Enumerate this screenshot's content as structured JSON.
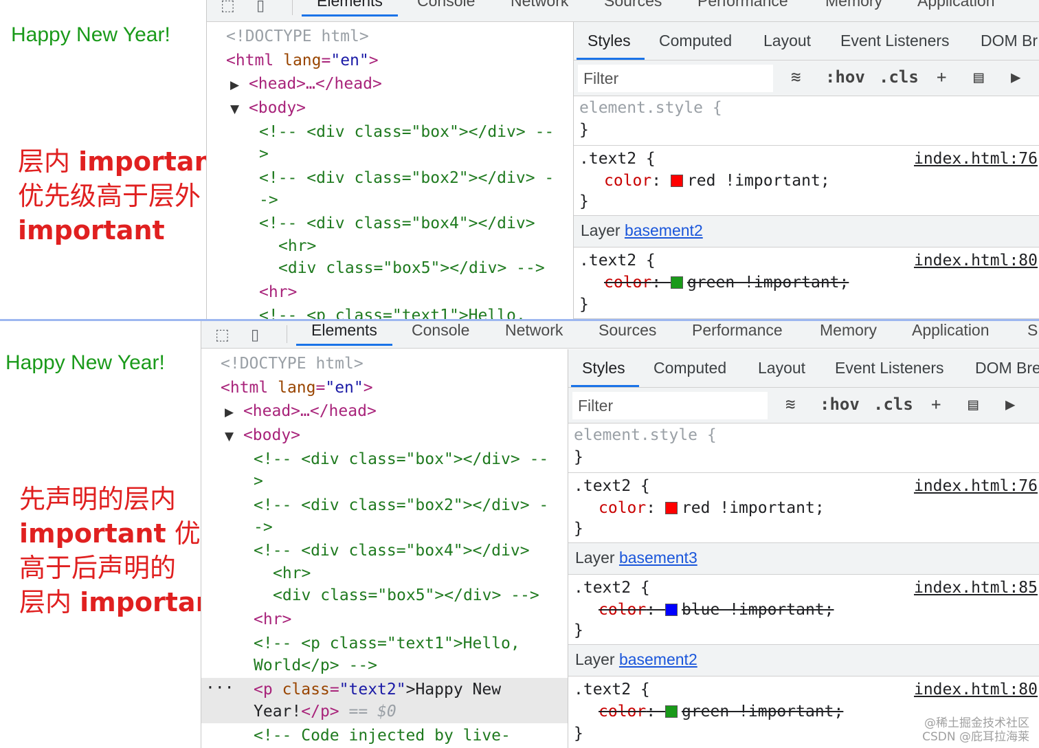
{
  "colors": {
    "tab_accent": "#1a73e8",
    "red": "#ff0000",
    "green": "#1a9a1a",
    "blue": "#0000ff"
  },
  "toolbar": {
    "inspect_icon": "inspect-element-icon",
    "device_icon": "device-toolbar-icon"
  },
  "top": {
    "happy": "Happy New Year!",
    "note_lines": [
      "层内 important",
      "优先级高于层外",
      "important"
    ],
    "tabs": [
      "Elements",
      "Console",
      "Network",
      "Sources",
      "Performance",
      "Memory",
      "Application"
    ],
    "elements": {
      "doctype": "<!DOCTYPE html>",
      "html_open": "<html",
      "html_attr": "lang",
      "html_val": "\"en\"",
      "gt": ">",
      "head": "<head>…</head>",
      "body": "<body>",
      "c1": "<!-- <div class=\"box\"></div> --",
      "c1b": ">",
      "c2": "<!-- <div class=\"box2\"></div> -",
      "c2b": "->",
      "c3": "<!-- <div class=\"box4\"></div>",
      "c3b": "<hr>",
      "c3c": "<div class=\"box5\"></div> -->",
      "hr": "<hr>",
      "c4": "<!-- <p class=\"text1\">Hello,"
    },
    "styles": {
      "subtabs": [
        "Styles",
        "Computed",
        "Layout",
        "Event Listeners",
        "DOM Br"
      ],
      "filter_placeholder": "Filter",
      "hov": ":hov",
      "cls": ".cls",
      "element_style": "element.style {",
      "close": "}",
      "rule1": {
        "selector": ".text2 {",
        "source": "index.html:76",
        "prop": "color",
        "value": "red !important;"
      },
      "layer1": {
        "label": "Layer",
        "name": "basement2"
      },
      "rule2": {
        "selector": ".text2 {",
        "source": "index.html:80",
        "prop": "color",
        "value": "green !important;"
      }
    }
  },
  "bottom": {
    "happy": "Happy New Year!",
    "note_lines": [
      "先声明的层内",
      "important 优先级",
      "高于后声明的",
      "层内 important"
    ],
    "tabs": [
      "Elements",
      "Console",
      "Network",
      "Sources",
      "Performance",
      "Memory",
      "Application",
      "S"
    ],
    "elements": {
      "doctype": "<!DOCTYPE html>",
      "html_open": "<html",
      "html_attr": "lang",
      "html_val": "\"en\"",
      "gt": ">",
      "head": "<head>…</head>",
      "body": "<body>",
      "c1": "<!-- <div class=\"box\"></div> --",
      "c1b": ">",
      "c2": "<!-- <div class=\"box2\"></div> -",
      "c2b": "->",
      "c3": "<!-- <div class=\"box4\"></div>",
      "c3b": "<hr>",
      "c3c": "<div class=\"box5\"></div> -->",
      "hr": "<hr>",
      "c4": "<!-- <p class=\"text1\">Hello,",
      "c4b": "World</p> -->",
      "sel_open": "<p",
      "sel_attr": "class",
      "sel_eq": "=",
      "sel_val": "\"text2\"",
      "sel_text": ">Happy New",
      "sel_text2": "Year!",
      "sel_close": "</p>",
      "sel_eqeq": "==",
      "sel_dollar": "$0",
      "dots": "···",
      "c5": "<!-- Code injected by live-"
    },
    "styles": {
      "subtabs": [
        "Styles",
        "Computed",
        "Layout",
        "Event Listeners",
        "DOM Bre"
      ],
      "filter_placeholder": "Filter",
      "hov": ":hov",
      "cls": ".cls",
      "element_style": "element.style {",
      "close": "}",
      "rule1": {
        "selector": ".text2 {",
        "source": "index.html:76",
        "prop": "color",
        "value": "red !important;"
      },
      "layer1": {
        "label": "Layer",
        "name": "basement3"
      },
      "rule2": {
        "selector": ".text2 {",
        "source": "index.html:85",
        "prop": "color",
        "value": "blue !important;"
      },
      "layer2": {
        "label": "Layer",
        "name": "basement2"
      },
      "rule3": {
        "selector": ".text2 {",
        "source": "index.html:80",
        "prop": "color",
        "value": "green !important;"
      }
    }
  },
  "watermark": {
    "line1": "@稀土掘金技术社区",
    "line2": "CSDN @庇耳拉海莱"
  }
}
